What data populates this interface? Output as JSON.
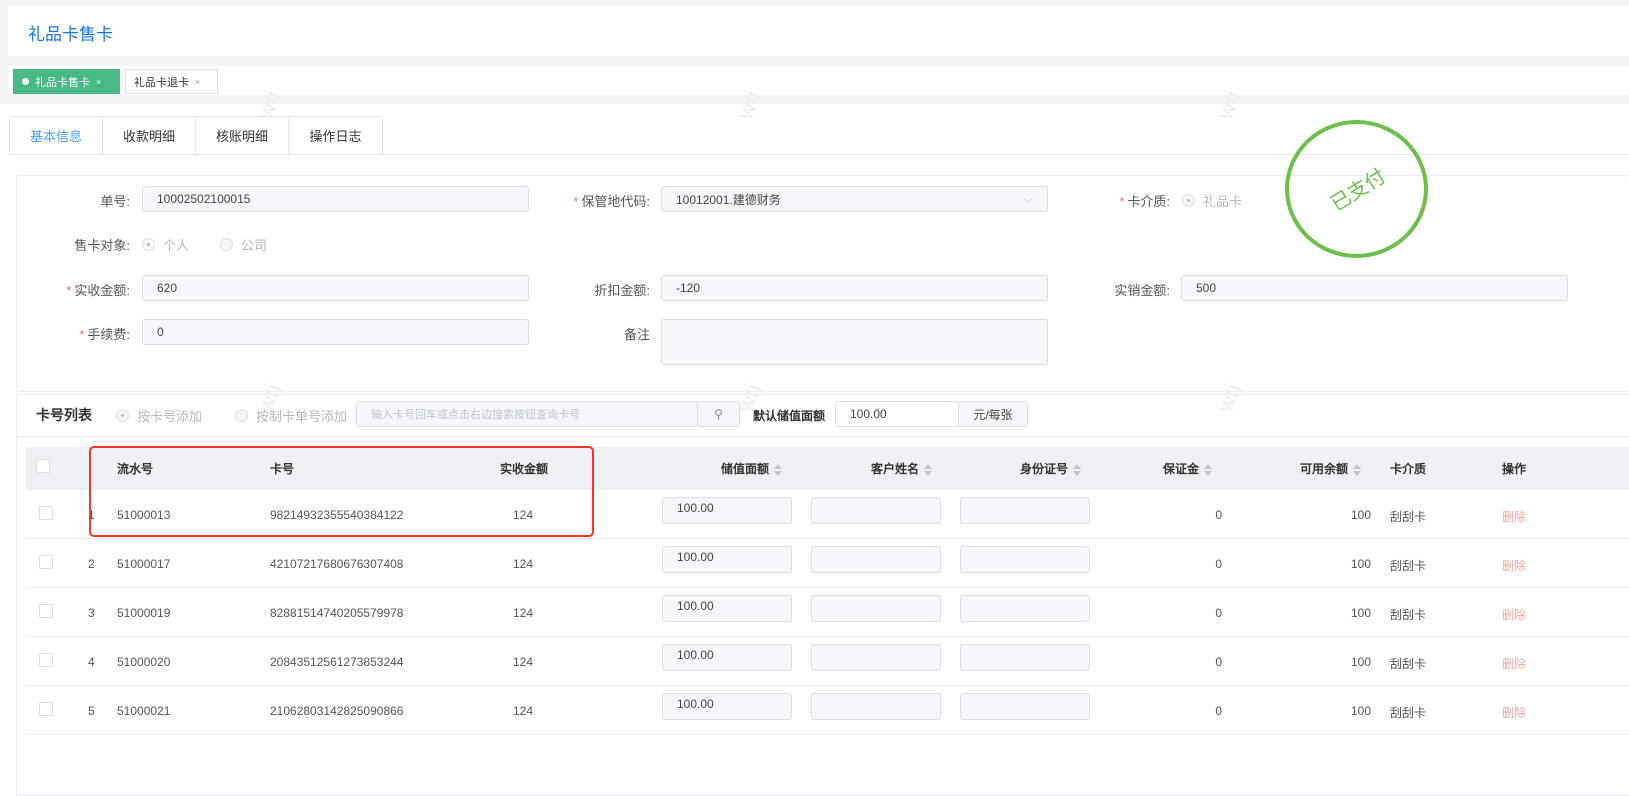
{
  "header": {
    "title": "礼品卡售卡"
  },
  "tags": [
    {
      "label": "礼品卡售卡",
      "active": true
    },
    {
      "label": "礼品卡退卡",
      "active": false
    }
  ],
  "tag_close": "×",
  "tabs": [
    "基本信息",
    "收款明细",
    "核账明细",
    "操作日志"
  ],
  "form": {
    "order_no_label": "单号:",
    "order_no": "10002502100015",
    "custody_label": "保管地代码:",
    "custody_value": "10012001.建德财务",
    "medium_label": "卡介质:",
    "medium_option": "礼品卡",
    "target_label": "售卡对象:",
    "target_options": [
      "个人",
      "公司"
    ],
    "received_label": "实收金额:",
    "received": "620",
    "discount_label": "折扣金额:",
    "discount": "-120",
    "sales_label": "实销金额:",
    "sales": "500",
    "fee_label": "手续费:",
    "fee": "0",
    "remark_label": "备注",
    "remark": ""
  },
  "stamp": "已支付",
  "watermark": "wrj",
  "card_list": {
    "title": "卡号列表",
    "add_modes": [
      "按卡号添加",
      "按制卡单号添加"
    ],
    "search_placeholder": "输入卡号回车或点击右边搜索按钮查询卡号",
    "default_value_label": "默认储值面额",
    "default_value": "100.00",
    "unit": "元/每张"
  },
  "table": {
    "columns": [
      "流水号",
      "卡号",
      "实收金额",
      "储值面额",
      "客户姓名",
      "身份证号",
      "保证金",
      "可用余额",
      "卡介质",
      "操作"
    ],
    "rows": [
      {
        "idx": "1",
        "serial": "51000013",
        "card": "98214932355540384122",
        "received": "124",
        "face": "100.00",
        "name": "",
        "id": "",
        "deposit": "0",
        "balance": "100",
        "medium": "刮刮卡",
        "action": "删除"
      },
      {
        "idx": "2",
        "serial": "51000017",
        "card": "42107217680676307408",
        "received": "124",
        "face": "100.00",
        "name": "",
        "id": "",
        "deposit": "0",
        "balance": "100",
        "medium": "刮刮卡",
        "action": "删除"
      },
      {
        "idx": "3",
        "serial": "51000019",
        "card": "82881514740205579978",
        "received": "124",
        "face": "100.00",
        "name": "",
        "id": "",
        "deposit": "0",
        "balance": "100",
        "medium": "刮刮卡",
        "action": "删除"
      },
      {
        "idx": "4",
        "serial": "51000020",
        "card": "20843512561273853244",
        "received": "124",
        "face": "100.00",
        "name": "",
        "id": "",
        "deposit": "0",
        "balance": "100",
        "medium": "刮刮卡",
        "action": "删除"
      },
      {
        "idx": "5",
        "serial": "51000021",
        "card": "21062803142825090866",
        "received": "124",
        "face": "100.00",
        "name": "",
        "id": "",
        "deposit": "0",
        "balance": "100",
        "medium": "刮刮卡",
        "action": "删除"
      }
    ]
  }
}
